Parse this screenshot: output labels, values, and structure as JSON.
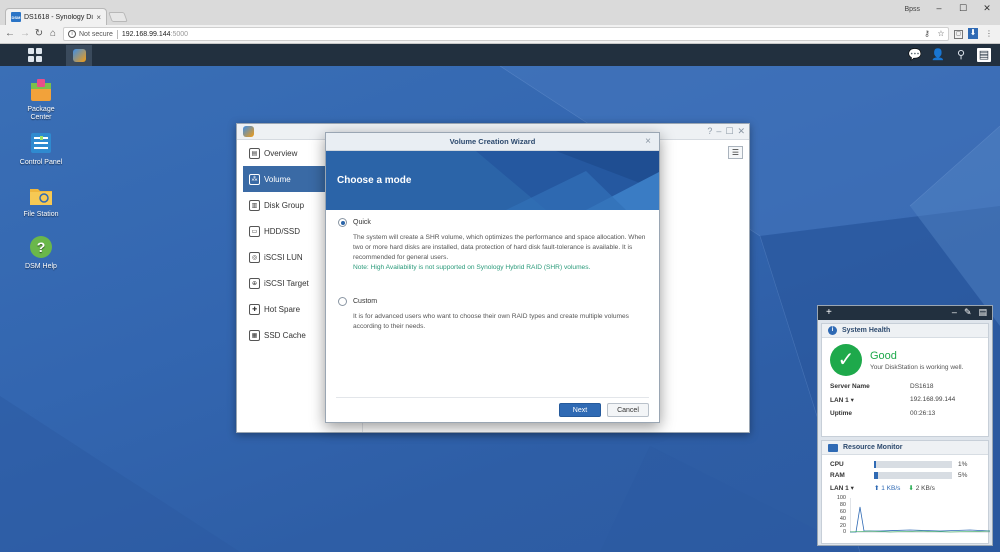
{
  "browser": {
    "tab_title": "DS1618 - Synology DiskS",
    "tab_close": "×",
    "favicon_text": "DSM",
    "user": "Bpss",
    "address": {
      "security": "Not secure",
      "host": "192.168.99.144",
      "port": ":5000"
    }
  },
  "desktop": {
    "icons": [
      {
        "label": "Package\nCenter"
      },
      {
        "label": "Control Panel"
      },
      {
        "label": "File Station"
      },
      {
        "label": "DSM Help"
      }
    ]
  },
  "storage_manager": {
    "title": "Storage Manager",
    "nav": [
      {
        "label": "Overview"
      },
      {
        "label": "Volume"
      },
      {
        "label": "Disk Group"
      },
      {
        "label": "HDD/SSD"
      },
      {
        "label": "iSCSI LUN"
      },
      {
        "label": "iSCSI Target"
      },
      {
        "label": "Hot Spare"
      },
      {
        "label": "SSD Cache"
      }
    ]
  },
  "wizard": {
    "title": "Volume Creation Wizard",
    "close": "×",
    "heading": "Choose a mode",
    "options": [
      {
        "label": "Quick",
        "checked": true,
        "description": "The system will create a SHR volume, which optimizes the performance and space allocation. When two or more hard disks are installed, data protection of hard disk fault-tolerance is available. It is recommended for general users.",
        "note": "Note: High Availability is not supported on Synology Hybrid RAID (SHR) volumes."
      },
      {
        "label": "Custom",
        "checked": false,
        "description": "It is for advanced users who want to choose their own RAID types and create multiple volumes according to their needs."
      }
    ],
    "next_label": "Next",
    "cancel_label": "Cancel"
  },
  "widgets": {
    "system_health": {
      "title": "System Health",
      "status": "Good",
      "status_sub": "Your DiskStation is working well.",
      "rows": [
        {
          "k": "Server Name",
          "v": "DS1618"
        },
        {
          "k": "LAN 1 ▾",
          "v": "192.168.99.144"
        },
        {
          "k": "Uptime",
          "v": "00:26:13"
        }
      ]
    },
    "resource_monitor": {
      "title": "Resource Monitor",
      "cpu_label": "CPU",
      "cpu_value": "1%",
      "cpu_fraction": 0.03,
      "ram_label": "RAM",
      "ram_value": "5%",
      "ram_fraction": 0.05,
      "lan_label": "LAN 1 ▾",
      "upload": "1 KB/s",
      "download": "2 KB/s",
      "chart_ticks": [
        "100",
        "80",
        "60",
        "40",
        "20",
        "0"
      ]
    }
  },
  "colors": {
    "accent": "#2f6ab4",
    "good": "#1ea94b",
    "dsm_bar": "#22303f"
  }
}
